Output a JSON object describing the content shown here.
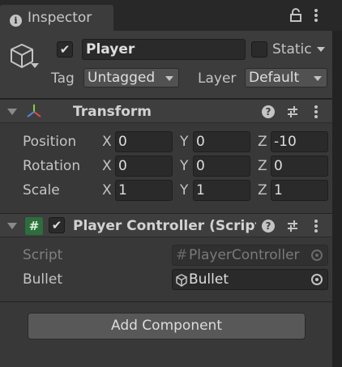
{
  "window": {
    "tab_title": "Inspector"
  },
  "header": {
    "name": "Player",
    "active_checked": true,
    "static_label": "Static",
    "static_checked": false,
    "tag_label": "Tag",
    "tag_value": "Untagged",
    "layer_label": "Layer",
    "layer_value": "Default"
  },
  "transform": {
    "title": "Transform",
    "rows": [
      {
        "label": "Position",
        "x": "0",
        "y": "0",
        "z": "-10"
      },
      {
        "label": "Rotation",
        "x": "0",
        "y": "0",
        "z": "0"
      },
      {
        "label": "Scale",
        "x": "1",
        "y": "1",
        "z": "1"
      }
    ],
    "axis": {
      "x": "X",
      "y": "Y",
      "z": "Z"
    }
  },
  "player_controller": {
    "title": "Player Controller (Script",
    "enabled": true,
    "script_label": "Script",
    "script_value": "PlayerController",
    "bullet_label": "Bullet",
    "bullet_value": "Bullet"
  },
  "footer": {
    "add_component": "Add Component"
  },
  "icons": {
    "info": "info-icon",
    "lock": "lock-icon",
    "menu": "kebab-menu-icon",
    "gameobject": "cube-icon",
    "transform": "transform-axes-icon",
    "script": "csharp-script-icon",
    "help": "help-icon",
    "presets": "presets-icon",
    "object_picker": "object-picker-icon",
    "prefab": "prefab-cube-icon"
  },
  "colors": {
    "background": "#383838",
    "field": "#2a2a2a",
    "script_icon": "#2c6e3c"
  }
}
